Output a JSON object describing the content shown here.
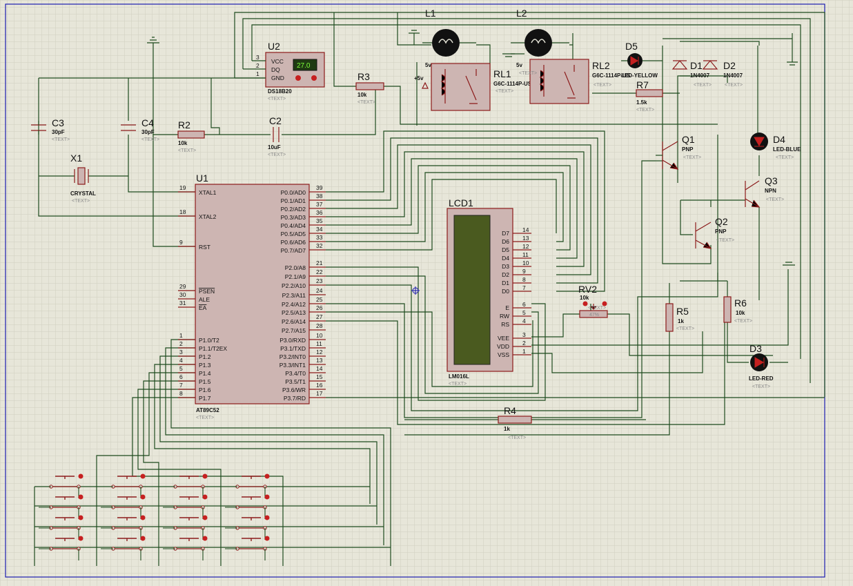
{
  "theme": {
    "sheet_bg": "#e7e6d9",
    "grid": "#cfcfc0",
    "wire": "#1d4a1d",
    "component": "#8b1a1a",
    "component_fill": "#cdb5b2",
    "border": "#1b1bb0",
    "lcd_screen": "#4a5a1f"
  },
  "placeholder": "<TEXT>",
  "components": {
    "u1": {
      "ref": "U1",
      "part": "AT89C52",
      "left_pins": [
        {
          "num": "19",
          "name": "XTAL1"
        },
        {
          "num": "18",
          "name": "XTAL2"
        },
        {
          "num": "9",
          "name": "RST"
        },
        {
          "num": "29",
          "name": "PSEN"
        },
        {
          "num": "30",
          "name": "ALE"
        },
        {
          "num": "31",
          "name": "EA"
        },
        {
          "num": "1",
          "name": "P1.0/T2"
        },
        {
          "num": "2",
          "name": "P1.1/T2EX"
        },
        {
          "num": "3",
          "name": "P1.2"
        },
        {
          "num": "4",
          "name": "P1.3"
        },
        {
          "num": "5",
          "name": "P1.4"
        },
        {
          "num": "6",
          "name": "P1.5"
        },
        {
          "num": "7",
          "name": "P1.6"
        },
        {
          "num": "8",
          "name": "P1.7"
        }
      ],
      "right_pins": [
        {
          "num": "39",
          "name": "P0.0/AD0"
        },
        {
          "num": "38",
          "name": "P0.1/AD1"
        },
        {
          "num": "37",
          "name": "P0.2/AD2"
        },
        {
          "num": "36",
          "name": "P0.3/AD3"
        },
        {
          "num": "35",
          "name": "P0.4/AD4"
        },
        {
          "num": "34",
          "name": "P0.5/AD5"
        },
        {
          "num": "33",
          "name": "P0.6/AD6"
        },
        {
          "num": "32",
          "name": "P0.7/AD7"
        },
        {
          "num": "21",
          "name": "P2.0/A8"
        },
        {
          "num": "22",
          "name": "P2.1/A9"
        },
        {
          "num": "23",
          "name": "P2.2/A10"
        },
        {
          "num": "24",
          "name": "P2.3/A11"
        },
        {
          "num": "25",
          "name": "P2.4/A12"
        },
        {
          "num": "26",
          "name": "P2.5/A13"
        },
        {
          "num": "27",
          "name": "P2.6/A14"
        },
        {
          "num": "28",
          "name": "P2.7/A15"
        },
        {
          "num": "10",
          "name": "P3.0/RXD"
        },
        {
          "num": "11",
          "name": "P3.1/TXD"
        },
        {
          "num": "12",
          "name": "P3.2/INT0"
        },
        {
          "num": "13",
          "name": "P3.3/INT1"
        },
        {
          "num": "14",
          "name": "P3.4/T0"
        },
        {
          "num": "15",
          "name": "P3.5/T1"
        },
        {
          "num": "16",
          "name": "P3.6/WR"
        },
        {
          "num": "17",
          "name": "P3.7/RD"
        }
      ]
    },
    "u2": {
      "ref": "U2",
      "part": "DS18B20",
      "display": "27.0",
      "pins": [
        {
          "num": "3",
          "name": "VCC"
        },
        {
          "num": "2",
          "name": "DQ"
        },
        {
          "num": "1",
          "name": "GND"
        }
      ]
    },
    "lcd1": {
      "ref": "LCD1",
      "part": "LM016L",
      "pins": [
        {
          "num": "14",
          "name": "D7"
        },
        {
          "num": "13",
          "name": "D6"
        },
        {
          "num": "12",
          "name": "D5"
        },
        {
          "num": "11",
          "name": "D4"
        },
        {
          "num": "10",
          "name": "D3"
        },
        {
          "num": "9",
          "name": "D2"
        },
        {
          "num": "8",
          "name": "D1"
        },
        {
          "num": "7",
          "name": "D0"
        },
        {
          "num": "6",
          "name": "E"
        },
        {
          "num": "5",
          "name": "RW"
        },
        {
          "num": "4",
          "name": "RS"
        },
        {
          "num": "3",
          "name": "VEE"
        },
        {
          "num": "2",
          "name": "VDD"
        },
        {
          "num": "1",
          "name": "VSS"
        }
      ]
    },
    "x1": {
      "ref": "X1",
      "part": "CRYSTAL"
    },
    "c3": {
      "ref": "C3",
      "value": "30pF"
    },
    "c4": {
      "ref": "C4",
      "value": "30pF"
    },
    "c2": {
      "ref": "C2",
      "value": "10uF"
    },
    "r2": {
      "ref": "R2",
      "value": "10k"
    },
    "r3": {
      "ref": "R3",
      "value": "10k"
    },
    "r4": {
      "ref": "R4",
      "value": "1k"
    },
    "r5": {
      "ref": "R5",
      "value": "1k"
    },
    "r6": {
      "ref": "R6",
      "value": "10k"
    },
    "r7": {
      "ref": "R7",
      "value": "1.5k"
    },
    "rv2": {
      "ref": "RV2",
      "value": "10k",
      "percent": "47%"
    },
    "l1": {
      "ref": "L1"
    },
    "l2": {
      "ref": "L2"
    },
    "rl1": {
      "ref": "RL1",
      "part": "G6C-1114P-US",
      "supply": "5v",
      "supply_alt": "+5v"
    },
    "rl2": {
      "ref": "RL2",
      "part": "G6C-1114P-US",
      "supply": "5v",
      "overlap_part": "LED-YELLOW"
    },
    "d1": {
      "ref": "D1",
      "part": "1N4007"
    },
    "d2": {
      "ref": "D2",
      "part": "1N4007"
    },
    "d3": {
      "ref": "D3",
      "part": "LED-RED"
    },
    "d4": {
      "ref": "D4",
      "part": "LED-BLUE"
    },
    "d5": {
      "ref": "D5"
    },
    "q1": {
      "ref": "Q1",
      "part": "PNP"
    },
    "q2": {
      "ref": "Q2",
      "part": "PNP"
    },
    "q3": {
      "ref": "Q3",
      "part": "NPN"
    }
  },
  "keypad": {
    "rows": 4,
    "cols": 4
  }
}
